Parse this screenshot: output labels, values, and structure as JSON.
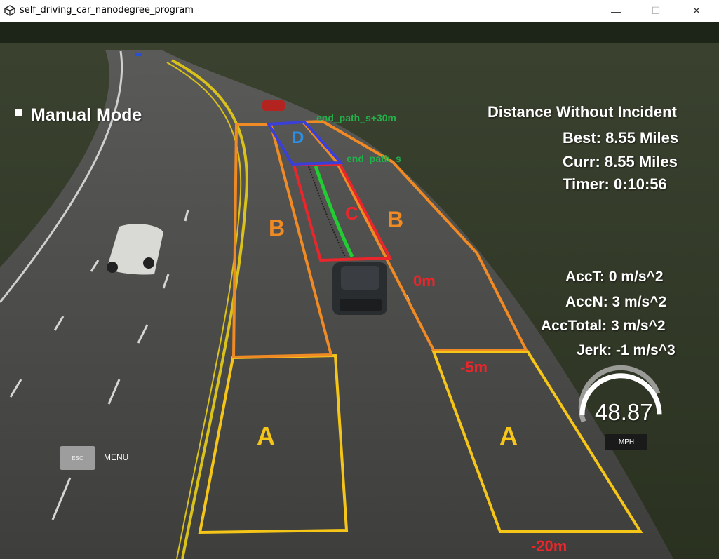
{
  "window": {
    "title": "self_driving_car_nanodegree_program",
    "minimize": "—",
    "maximize": "☐",
    "close": "✕"
  },
  "hud": {
    "mode": "Manual Mode",
    "distance_title": "Distance Without Incident",
    "best": "Best: 8.55 Miles",
    "curr": "Curr: 8.55 Miles",
    "timer": "Timer: 0:10:56",
    "acct": "AccT: 0 m/s^2",
    "accn": "AccN: 3 m/s^2",
    "acctotal": "AccTotal: 3 m/s^2",
    "jerk": "Jerk: -1 m/s^3",
    "speed": "48.87",
    "speed_unit": "MPH",
    "speed_fraction": 0.78,
    "esc_label": "ESC",
    "menu_label": "MENU"
  },
  "annotations": {
    "zone_a_left": "A",
    "zone_a_right": "A",
    "zone_b_left": "B",
    "zone_b_right": "B",
    "zone_c": "C",
    "zone_d": "D",
    "end_path_s_plus": "end_path_s+30m",
    "end_path_s": "end_path_s",
    "dist_0": "0m",
    "dist_5": "-5m",
    "dist_20": "-20m"
  },
  "colors": {
    "zone_a": "#f5c518",
    "zone_b": "#f08a24",
    "zone_c": "#e8262b",
    "zone_d": "#3a3fd8",
    "path": "#22cc33",
    "road": "#4a4a4a",
    "grass": "#2f3a22"
  }
}
